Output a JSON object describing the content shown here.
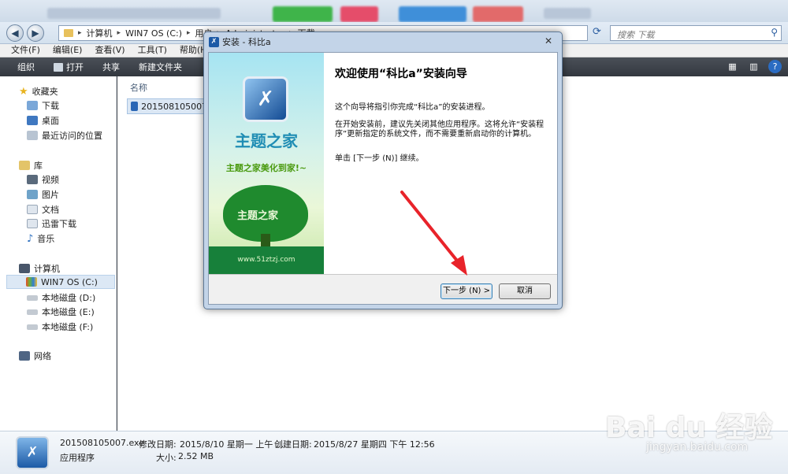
{
  "explorer": {
    "breadcrumb": [
      "计算机",
      "WIN7 OS (C:)",
      "用户",
      "Administrator",
      "下载"
    ],
    "search_placeholder": "搜索 下载",
    "menu": [
      "文件(F)",
      "编辑(E)",
      "查看(V)",
      "工具(T)",
      "帮助(H)"
    ],
    "toolbar": [
      "组织",
      "打开",
      "共享",
      "新建文件夹"
    ],
    "nav": {
      "favorites_header": "收藏夹",
      "favorites": [
        "下载",
        "桌面",
        "最近访问的位置"
      ],
      "libraries_header": "库",
      "libraries": [
        "视频",
        "图片",
        "文档",
        "迅雷下载",
        "音乐"
      ],
      "computer_header": "计算机",
      "drives": [
        "WIN7 OS (C:)",
        "本地磁盘 (D:)",
        "本地磁盘 (E:)",
        "本地磁盘 (F:)"
      ],
      "network_header": "网络"
    },
    "column_header": "名称",
    "file_name": "201508105007.exe",
    "details": {
      "file_name": "201508105007.exe",
      "modified_label": "修改日期:",
      "modified_value": "2015/8/10 星期一 上午 ...",
      "created_label": "创建日期:",
      "created_value": "2015/8/27 星期四 下午 12:56",
      "type": "应用程序",
      "size_label": "大小:",
      "size_value": "2.52 MB"
    }
  },
  "dialog": {
    "title": "安装 - 科比a",
    "heading": "欢迎使用“科比a”安装向导",
    "para1": "这个向导将指引你完成“科比a”的安装进程。",
    "para2": "在开始安装前，建议先关闭其他应用程序。这将允许“安装程序”更新指定的系统文件，而不需要重新启动你的计算机。",
    "para3": "单击 [下一步 (N)] 继续。",
    "next_button": "下一步 (N) >",
    "cancel_button": "取消",
    "banner": {
      "brand": "主题之家",
      "slogan": "主题之家美化到家!~",
      "tree_text": "主题之家",
      "url": "www.51ztzj.com"
    }
  },
  "watermark": {
    "main": "Bai du 经验",
    "sub": "jingyan.baidu.com"
  },
  "colors": {
    "toolbar_bg": "#3c4148",
    "selection": "#dce8f5",
    "arrow": "#e8232a",
    "brand_blue": "#1c5aa6"
  },
  "icons": {
    "back": "arrow-left-icon",
    "forward": "arrow-right-icon",
    "refresh": "refresh-icon",
    "search": "search-icon",
    "close": "close-icon",
    "help": "help-icon"
  }
}
